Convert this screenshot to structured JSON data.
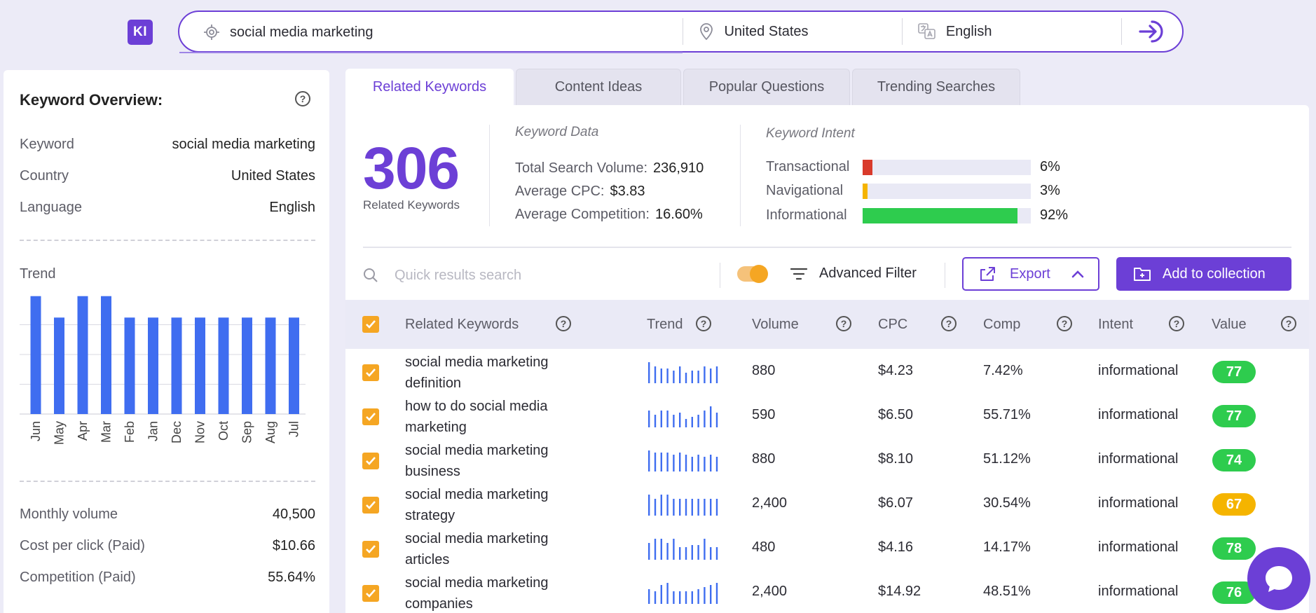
{
  "logo": {
    "text": "KI"
  },
  "search": {
    "keyword": "social media marketing",
    "country": "United States",
    "language": "English"
  },
  "overview": {
    "title": "Keyword Overview:",
    "rows": [
      {
        "label": "Keyword",
        "value": "social media marketing"
      },
      {
        "label": "Country",
        "value": "United States"
      },
      {
        "label": "Language",
        "value": "English"
      }
    ],
    "trend_label": "Trend",
    "stats": [
      {
        "label": "Monthly volume",
        "value": "40,500"
      },
      {
        "label": "Cost per click (Paid)",
        "value": "$10.66"
      },
      {
        "label": "Competition (Paid)",
        "value": "55.64%"
      }
    ]
  },
  "chart_data": {
    "type": "bar",
    "categories": [
      "Jun",
      "May",
      "Apr",
      "Mar",
      "Feb",
      "Jan",
      "Dec",
      "Nov",
      "Oct",
      "Sep",
      "Aug",
      "Jul"
    ],
    "values": [
      49500,
      40500,
      49500,
      49500,
      40500,
      40500,
      40500,
      40500,
      40500,
      40500,
      40500,
      40500
    ],
    "title": "Trend",
    "xlabel": "",
    "ylabel": "",
    "ylim": [
      0,
      50000
    ],
    "grid": true,
    "color": "#3f6df0"
  },
  "tabs": [
    {
      "label": "Related Keywords",
      "active": true
    },
    {
      "label": "Content Ideas",
      "active": false
    },
    {
      "label": "Popular Questions",
      "active": false
    },
    {
      "label": "Trending Searches",
      "active": false
    }
  ],
  "summary": {
    "count": "306",
    "count_label": "Related Keywords",
    "data_title": "Keyword Data",
    "data_rows": [
      {
        "label": "Total Search Volume:",
        "value": "236,910"
      },
      {
        "label": "Average CPC:",
        "value": "$3.83"
      },
      {
        "label": "Average Competition:",
        "value": "16.60%"
      }
    ],
    "intent_title": "Keyword Intent",
    "intents": [
      {
        "label": "Transactional",
        "pct": "6%",
        "fraction": 0.06,
        "color": "#d93a2b"
      },
      {
        "label": "Navigational",
        "pct": "3%",
        "fraction": 0.03,
        "color": "#f5b400"
      },
      {
        "label": "Informational",
        "pct": "92%",
        "fraction": 0.92,
        "color": "#2ecc4e"
      }
    ]
  },
  "toolbar": {
    "search_placeholder": "Quick results search",
    "advanced_filter": "Advanced Filter",
    "export": "Export",
    "add_collection": "Add to collection"
  },
  "table": {
    "headers": {
      "keyword": "Related Keywords",
      "trend": "Trend",
      "volume": "Volume",
      "cpc": "CPC",
      "comp": "Comp",
      "intent": "Intent",
      "value": "Value"
    },
    "rows": [
      {
        "kw1": "social media marketing",
        "kw2": "definition",
        "volume": "880",
        "cpc": "$4.23",
        "comp": "7.42%",
        "intent": "informational",
        "value": "77",
        "value_color": "#2ecc4e",
        "trend": [
          10,
          8,
          7,
          7,
          6,
          8,
          5,
          6,
          6,
          8,
          7,
          8
        ]
      },
      {
        "kw1": "how to do social media",
        "kw2": "marketing",
        "volume": "590",
        "cpc": "$6.50",
        "comp": "55.71%",
        "intent": "informational",
        "value": "77",
        "value_color": "#2ecc4e",
        "trend": [
          8,
          6,
          8,
          8,
          6,
          7,
          4,
          5,
          6,
          8,
          10,
          7
        ]
      },
      {
        "kw1": "social media marketing",
        "kw2": "business",
        "volume": "880",
        "cpc": "$8.10",
        "comp": "51.12%",
        "intent": "informational",
        "value": "74",
        "value_color": "#2ecc4e",
        "trend": [
          10,
          9,
          9,
          9,
          8,
          9,
          8,
          7,
          8,
          7,
          8,
          7
        ]
      },
      {
        "kw1": "social media marketing",
        "kw2": "strategy",
        "volume": "2,400",
        "cpc": "$6.07",
        "comp": "30.54%",
        "intent": "informational",
        "value": "67",
        "value_color": "#f5b400",
        "trend": [
          10,
          8,
          10,
          10,
          8,
          8,
          8,
          8,
          8,
          8,
          8,
          8
        ]
      },
      {
        "kw1": "social media marketing",
        "kw2": "articles",
        "volume": "480",
        "cpc": "$4.16",
        "comp": "14.17%",
        "intent": "informational",
        "value": "78",
        "value_color": "#2ecc4e",
        "trend": [
          8,
          10,
          10,
          8,
          10,
          6,
          6,
          7,
          7,
          10,
          6,
          6
        ]
      },
      {
        "kw1": "social media marketing",
        "kw2": "companies",
        "volume": "2,400",
        "cpc": "$14.92",
        "comp": "48.51%",
        "intent": "informational",
        "value": "76",
        "value_color": "#2ecc4e",
        "trend": [
          7,
          6,
          9,
          10,
          6,
          6,
          6,
          6,
          7,
          8,
          9,
          10
        ]
      }
    ]
  }
}
